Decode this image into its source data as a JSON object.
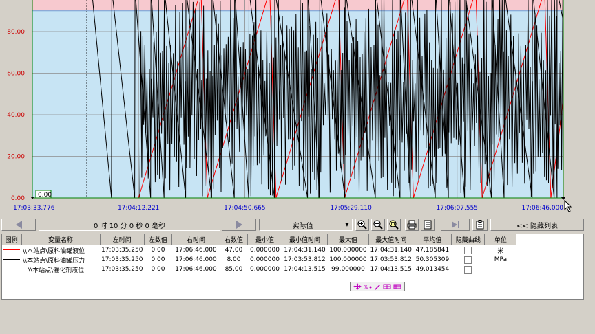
{
  "chart_data": {
    "type": "line",
    "y_ticks": [
      "80.00",
      "60.00",
      "40.00",
      "20.00",
      "0.00"
    ],
    "x_ticks": [
      "17:03:33.776",
      "17:04:12.221",
      "17:04:50.665",
      "17:05:29.110",
      "17:06:07.555",
      "17:06:46.000"
    ],
    "ylim": [
      0,
      100
    ],
    "cursor_value": "0.00",
    "bands": {
      "alarm_high": 90,
      "alarm_color": "#f7c9cf",
      "normal_color": "#c7e4f4"
    },
    "series": [
      {
        "name": "\\\\本站点\\原料油罐液位",
        "color": "#ff0000",
        "pattern": "ramp",
        "x": [
          17,
          27,
          28,
          38,
          39,
          49,
          50,
          60,
          61,
          71,
          72,
          82,
          83,
          85
        ],
        "y": [
          0,
          100,
          0,
          100,
          0,
          100,
          0,
          100,
          0,
          100,
          0,
          100,
          0,
          47
        ]
      },
      {
        "name": "\\\\本站点\\原料油罐压力",
        "color": "#000000",
        "pattern": "noise",
        "mean": 50.3,
        "end": 8
      },
      {
        "name": "\\\\本站点\\催化剂液位",
        "color": "#000000",
        "pattern": "sawtooth",
        "end": 85
      }
    ]
  },
  "toolbar": {
    "duration": "0 时 10 分 0 秒 0 毫秒",
    "value_mode": "实际值",
    "hide_list": "<< 隐藏列表"
  },
  "table": {
    "headers": [
      "图例",
      "变量名称",
      "左时间",
      "左数值",
      "右时间",
      "右数值",
      "最小值",
      "最小值时间",
      "最大值",
      "最大值时间",
      "平均值",
      "隐藏曲线",
      "单位"
    ],
    "rows": [
      {
        "color": "#ff0000",
        "name": "\\\\本站点\\原料油罐液位",
        "left_time": "17:03:35.250",
        "left_val": "0.00",
        "right_time": "17:06:46.000",
        "right_val": "47.00",
        "min": "0.000000",
        "min_time": "17:04:31.140",
        "max": "100.000000",
        "max_time": "17:04:31.140",
        "avg": "47.185841",
        "unit": "米"
      },
      {
        "color": "#000000",
        "name": "\\\\本站点\\原料油罐压力",
        "left_time": "17:03:35.250",
        "left_val": "0.00",
        "right_time": "17:06:46.000",
        "right_val": "8.00",
        "min": "0.000000",
        "min_time": "17:03:53.812",
        "max": "100.000000",
        "max_time": "17:03:53.812",
        "avg": "50.305309",
        "unit": "MPa"
      },
      {
        "color": "#000000",
        "name": "\\\\本站点\\催化剂液位",
        "left_time": "17:03:35.250",
        "left_val": "0.00",
        "right_time": "17:06:46.000",
        "right_val": "85.00",
        "min": "0.000000",
        "min_time": "17:04:13.515",
        "max": "99.000000",
        "max_time": "17:04:13.515",
        "avg": "49.013454",
        "unit": ""
      }
    ]
  }
}
